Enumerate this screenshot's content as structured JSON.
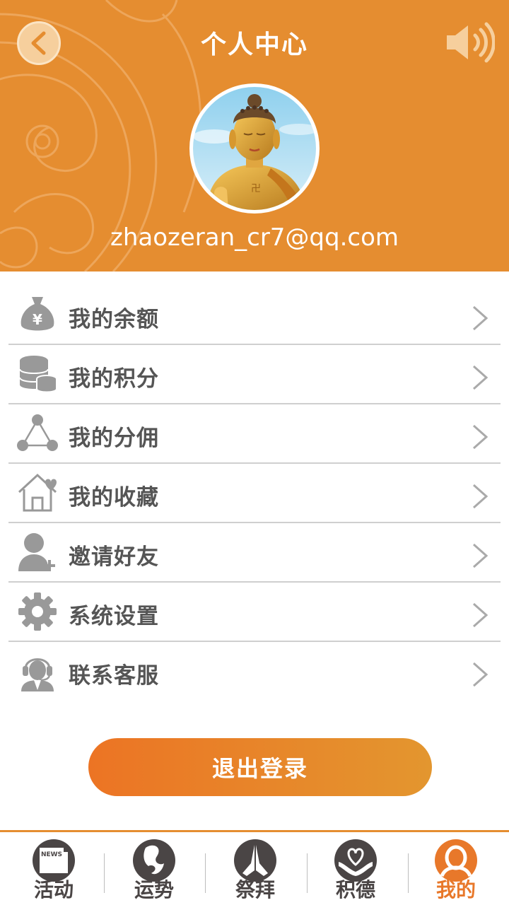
{
  "header": {
    "title": "个人中心",
    "back_icon": "chevron-left-icon",
    "sound_icon": "speaker-icon",
    "email": "zhaozeran_cr7@qq.com",
    "accent_color": "#e58d30"
  },
  "menu": {
    "items": [
      {
        "label": "我的余额",
        "icon": "money-bag-icon"
      },
      {
        "label": "我的积分",
        "icon": "coin-stack-icon"
      },
      {
        "label": "我的分佣",
        "icon": "share-nodes-icon"
      },
      {
        "label": "我的收藏",
        "icon": "house-heart-icon"
      },
      {
        "label": "邀请好友",
        "icon": "add-user-icon"
      },
      {
        "label": "系统设置",
        "icon": "gear-icon"
      },
      {
        "label": "联系客服",
        "icon": "customer-service-icon"
      }
    ]
  },
  "logout": {
    "label": "退出登录"
  },
  "tabbar": {
    "tabs": [
      {
        "label": "活动",
        "icon": "news-icon",
        "active": false
      },
      {
        "label": "运势",
        "icon": "fortune-icon",
        "active": false
      },
      {
        "label": "祭拜",
        "icon": "praying-hands-icon",
        "active": false
      },
      {
        "label": "积德",
        "icon": "heart-hands-icon",
        "active": false
      },
      {
        "label": "我的",
        "icon": "user-icon",
        "active": true
      }
    ],
    "active_color": "#e8782a"
  }
}
